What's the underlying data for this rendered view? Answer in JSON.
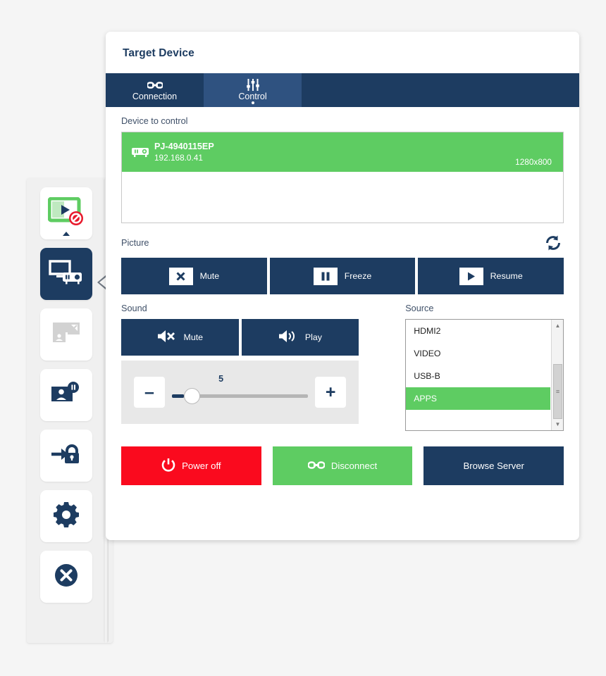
{
  "card": {
    "title": "Target Device",
    "tabs": [
      {
        "label": "Connection",
        "icon": "link-icon",
        "active": false
      },
      {
        "label": "Control",
        "icon": "sliders-icon",
        "active": true
      }
    ],
    "device_section_label": "Device to control",
    "device": {
      "name": "PJ-4940115EP",
      "ip": "192.168.0.41",
      "resolution": "1280x800",
      "icon": "projector-icon",
      "selected": true
    },
    "picture": {
      "label": "Picture",
      "refresh_icon": "refresh-icon",
      "buttons": [
        {
          "label": "Mute",
          "icon": "x-icon"
        },
        {
          "label": "Freeze",
          "icon": "pause-icon"
        },
        {
          "label": "Resume",
          "icon": "play-icon"
        }
      ]
    },
    "sound": {
      "label": "Sound",
      "buttons": [
        {
          "label": "Mute",
          "icon": "speaker-mute-icon"
        },
        {
          "label": "Play",
          "icon": "speaker-on-icon"
        }
      ],
      "volume": {
        "value": "5",
        "decrease_label": "–",
        "increase_label": "+",
        "percent": 9
      }
    },
    "source": {
      "label": "Source",
      "options": [
        "HDMI2",
        "VIDEO",
        "USB-B",
        "APPS"
      ],
      "selected": "APPS",
      "scroll_up_icon": "caret-up-icon",
      "scroll_down_icon": "caret-down-icon"
    },
    "actions": [
      {
        "label": "Power off",
        "icon": "power-icon",
        "color": "#fa0a1e"
      },
      {
        "label": "Disconnect",
        "icon": "link-icon",
        "color": "#5ecc62"
      },
      {
        "label": "Browse Server",
        "icon": "none",
        "color": "#1d3c61"
      }
    ]
  },
  "sidebar": {
    "items": [
      {
        "name": "present-stop",
        "icon": "screen-play-blocked-icon",
        "state": "green",
        "active": false,
        "has_caret": true
      },
      {
        "name": "target-device",
        "icon": "monitor-projector-icon",
        "state": "navy",
        "active": true,
        "has_caret": false
      },
      {
        "name": "screen-extend",
        "icon": "screen-expand-icon",
        "state": "disabled",
        "active": false,
        "has_caret": false
      },
      {
        "name": "presenter-pause",
        "icon": "user-screen-pause-icon",
        "state": "navy",
        "active": false,
        "has_caret": false
      },
      {
        "name": "login-lock",
        "icon": "login-lock-icon",
        "state": "navy",
        "active": false,
        "has_caret": false
      },
      {
        "name": "settings",
        "icon": "gear-icon",
        "state": "navy",
        "active": false,
        "has_caret": false
      },
      {
        "name": "exit",
        "icon": "close-circle-icon",
        "state": "navy",
        "active": false,
        "has_caret": false
      }
    ],
    "collapse_icon": "caret-left-icon"
  },
  "colors": {
    "navy": "#1d3c61",
    "navy_light": "#2f5280",
    "green": "#5ecc62",
    "red": "#fa0a1e",
    "background": "#f5f5f5"
  }
}
